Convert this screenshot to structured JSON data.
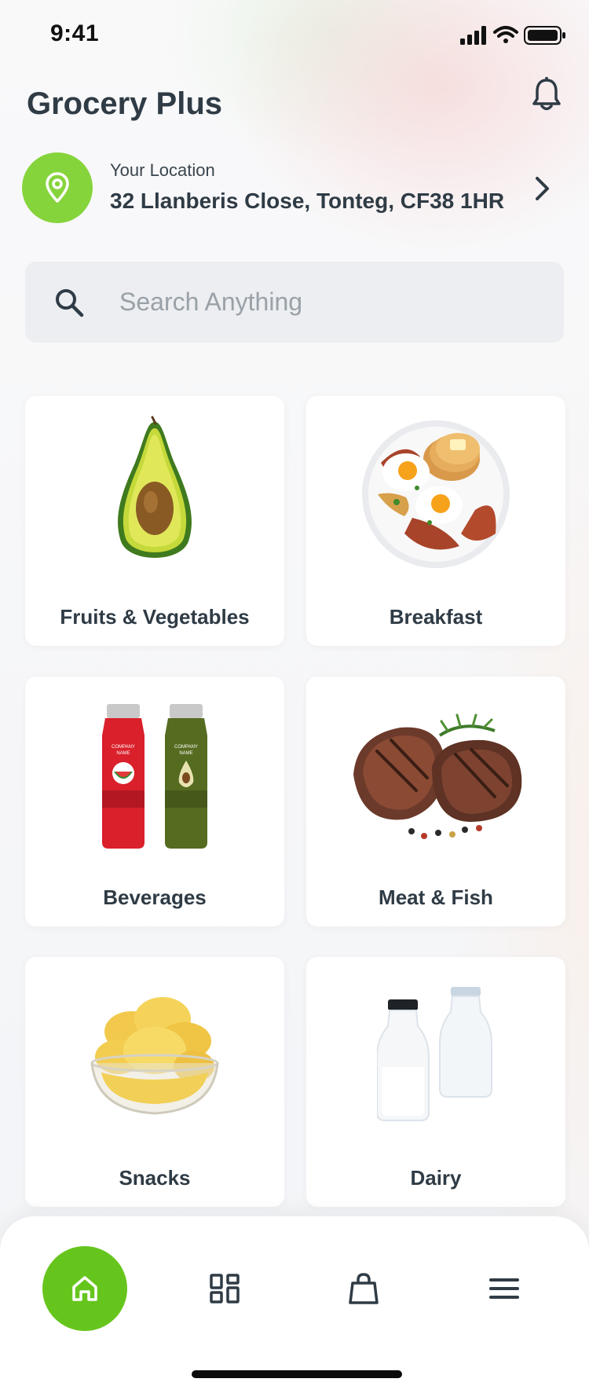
{
  "status_bar": {
    "time": "9:41"
  },
  "header": {
    "title": "Grocery Plus"
  },
  "location": {
    "label": "Your Location",
    "address": "32 Llanberis Close, Tonteg, CF38 1HR"
  },
  "search": {
    "placeholder": "Search Anything",
    "value": ""
  },
  "categories": [
    {
      "label": "Fruits & Vegetables",
      "icon": "avocado-image"
    },
    {
      "label": "Breakfast",
      "icon": "breakfast-plate-image"
    },
    {
      "label": "Beverages",
      "icon": "juice-bottles-image"
    },
    {
      "label": "Meat & Fish",
      "icon": "steak-image"
    },
    {
      "label": "Snacks",
      "icon": "chips-bowl-image"
    },
    {
      "label": "Dairy",
      "icon": "milk-bottles-image"
    }
  ],
  "bottom_nav": {
    "items": [
      {
        "name": "home",
        "icon": "home-icon",
        "active": true
      },
      {
        "name": "categories",
        "icon": "grid-icon",
        "active": false
      },
      {
        "name": "cart",
        "icon": "shopping-bag-icon",
        "active": false
      },
      {
        "name": "menu",
        "icon": "menu-icon",
        "active": false
      }
    ]
  },
  "colors": {
    "accent": "#66c51d",
    "pin": "#86d43c",
    "text": "#2f3b45"
  }
}
